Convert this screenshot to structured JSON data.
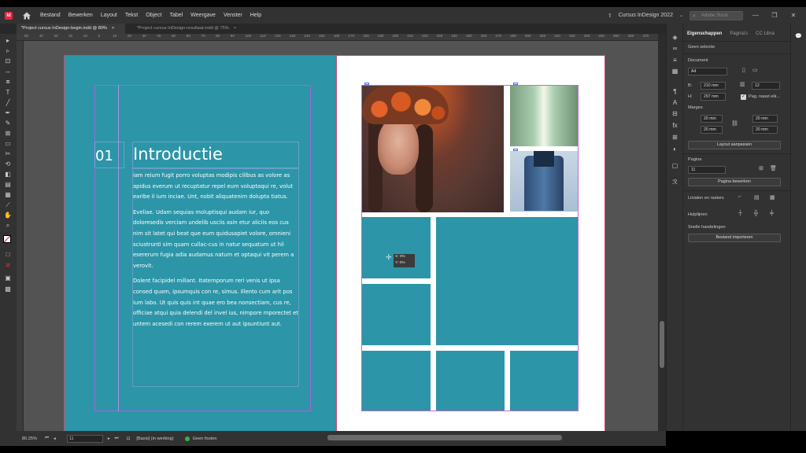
{
  "app": {
    "menus": [
      "Bestand",
      "Bewerken",
      "Layout",
      "Tekst",
      "Object",
      "Tabel",
      "Weergave",
      "Venster",
      "Help"
    ],
    "workspace": "Cursus InDesign 2022",
    "stock_search_placeholder": "Adobe Stock",
    "logo": "Id"
  },
  "tabs": [
    {
      "label": "*Project cursus InDesign-begin.indd @ 80%",
      "active": true
    },
    {
      "label": "*Project cursus InDesign-resultaat.indd @ 75%",
      "active": false
    }
  ],
  "ruler_ticks": [
    "50",
    "40",
    "30",
    "20",
    "10",
    "0",
    "10",
    "20",
    "30",
    "40",
    "50",
    "60",
    "70",
    "80",
    "90",
    "100",
    "110",
    "120",
    "130",
    "140",
    "150",
    "160",
    "170",
    "180",
    "190",
    "200",
    "210",
    "220",
    "230",
    "240",
    "250",
    "260",
    "270",
    "280",
    "290",
    "300",
    "310",
    "320",
    "330",
    "340",
    "350",
    "360",
    "370"
  ],
  "page": {
    "chapter_number": "01",
    "chapter_title": "Introductie",
    "paragraphs": [
      "iam reium fugit porro voluptas modipis cilibus as volore as apidus everum ut recuptatur repel eum voluptaqui re, volut earibe il ium inciae. Unt, nobit aliquatenim dolupta tiatus.",
      "Eveliae. Udam sequias moluptisqui audam iur, quo doloresedis verciam undelib usciis asin etur aliciis eos cus nim sit latet qui beat que eum quidusapiet volore, omnieni sciustrunti sim quam cullac-cus in natur sequatum ut hil esererum fugia adia audamus natum et optaqui vit perem a verovit.",
      "Dolent facipidel millant. Itatemporum reri venis ut ipsa consed quam, ipsumquis con re, simus. Illento cum arit pos ium labo. Ut quis quis int quae ero bea nonsectiam, cus re, officiae atqui quia delendi del invel ius, nimpore mporectet et untem acesedi con rerem exerem ut aut ipsuntiunt aut."
    ]
  },
  "cursor": {
    "x_label": "X: 0%",
    "y_label": "Y: 0%"
  },
  "status": {
    "zoom": "80.25%",
    "page": "11",
    "style": "[Basis] (in werking)",
    "preflight": "Geen fouten",
    "preflight_color": "#3fae49"
  },
  "props": {
    "tabs": [
      "Eigenschappen",
      "Pagina's",
      "CC Libra"
    ],
    "no_selection": "Geen selectie",
    "document_label": "Document",
    "page_size": "A4",
    "width_label": "B:",
    "width": "210 mm",
    "height_label": "H:",
    "height": "297 mm",
    "pages": "12",
    "facing_pages_label": "Pag. naast elk...",
    "margins_label": "Marges",
    "margin_top": "20 mm",
    "margin_bottom": "20 mm",
    "margin_inside": "20 mm",
    "margin_outside": "20 mm",
    "adjust_layout": "Layout aanpassen",
    "page_label": "Pagina",
    "page_value": "11",
    "edit_page": "Pagina bewerken",
    "rulers_grids": "Linialen en rasters",
    "guides": "Hulplijnen",
    "quick_actions": "Snelle handelingen",
    "import_file": "Bestand importeren"
  },
  "colors": {
    "accent_teal": "#2c95a8",
    "page_bleed": "#c94a6a",
    "margin_guide": "#9b6bd6",
    "doc_logo": "#e6263c"
  }
}
